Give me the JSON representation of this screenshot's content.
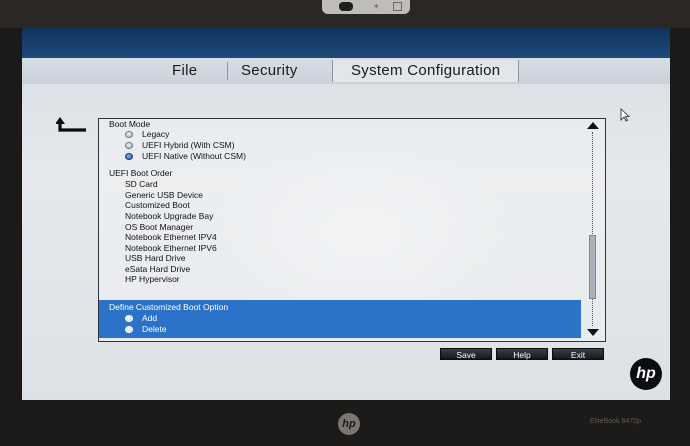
{
  "menu": {
    "tabs": [
      {
        "label": "File"
      },
      {
        "label": "Security"
      },
      {
        "label": "System Configuration"
      }
    ]
  },
  "boot_mode": {
    "heading": "Boot Mode",
    "options": [
      {
        "label": "Legacy",
        "selected": false
      },
      {
        "label": "UEFI Hybrid (With CSM)",
        "selected": false
      },
      {
        "label": "UEFI Native (Without CSM)",
        "selected": true
      }
    ]
  },
  "boot_order": {
    "heading": "UEFI Boot Order",
    "items": [
      "SD Card",
      "Generic USB Device",
      "Customized Boot",
      "Notebook Upgrade Bay",
      "OS Boot Manager",
      "Notebook Ethernet IPV4",
      "Notebook Ethernet IPV6",
      "USB Hard Drive",
      "eSata Hard Drive",
      "HP Hypervisor"
    ]
  },
  "custom_boot": {
    "heading": "Define Customized Boot Option",
    "options": [
      {
        "label": "Add"
      },
      {
        "label": "Delete"
      }
    ]
  },
  "buttons": {
    "save": "Save",
    "help": "Help",
    "exit": "Exit"
  },
  "branding": {
    "logo_text": "hp",
    "model": "EliteBook 8470p"
  },
  "colors": {
    "highlight": "#2a73c9",
    "top_band": "#1e4a7c"
  }
}
